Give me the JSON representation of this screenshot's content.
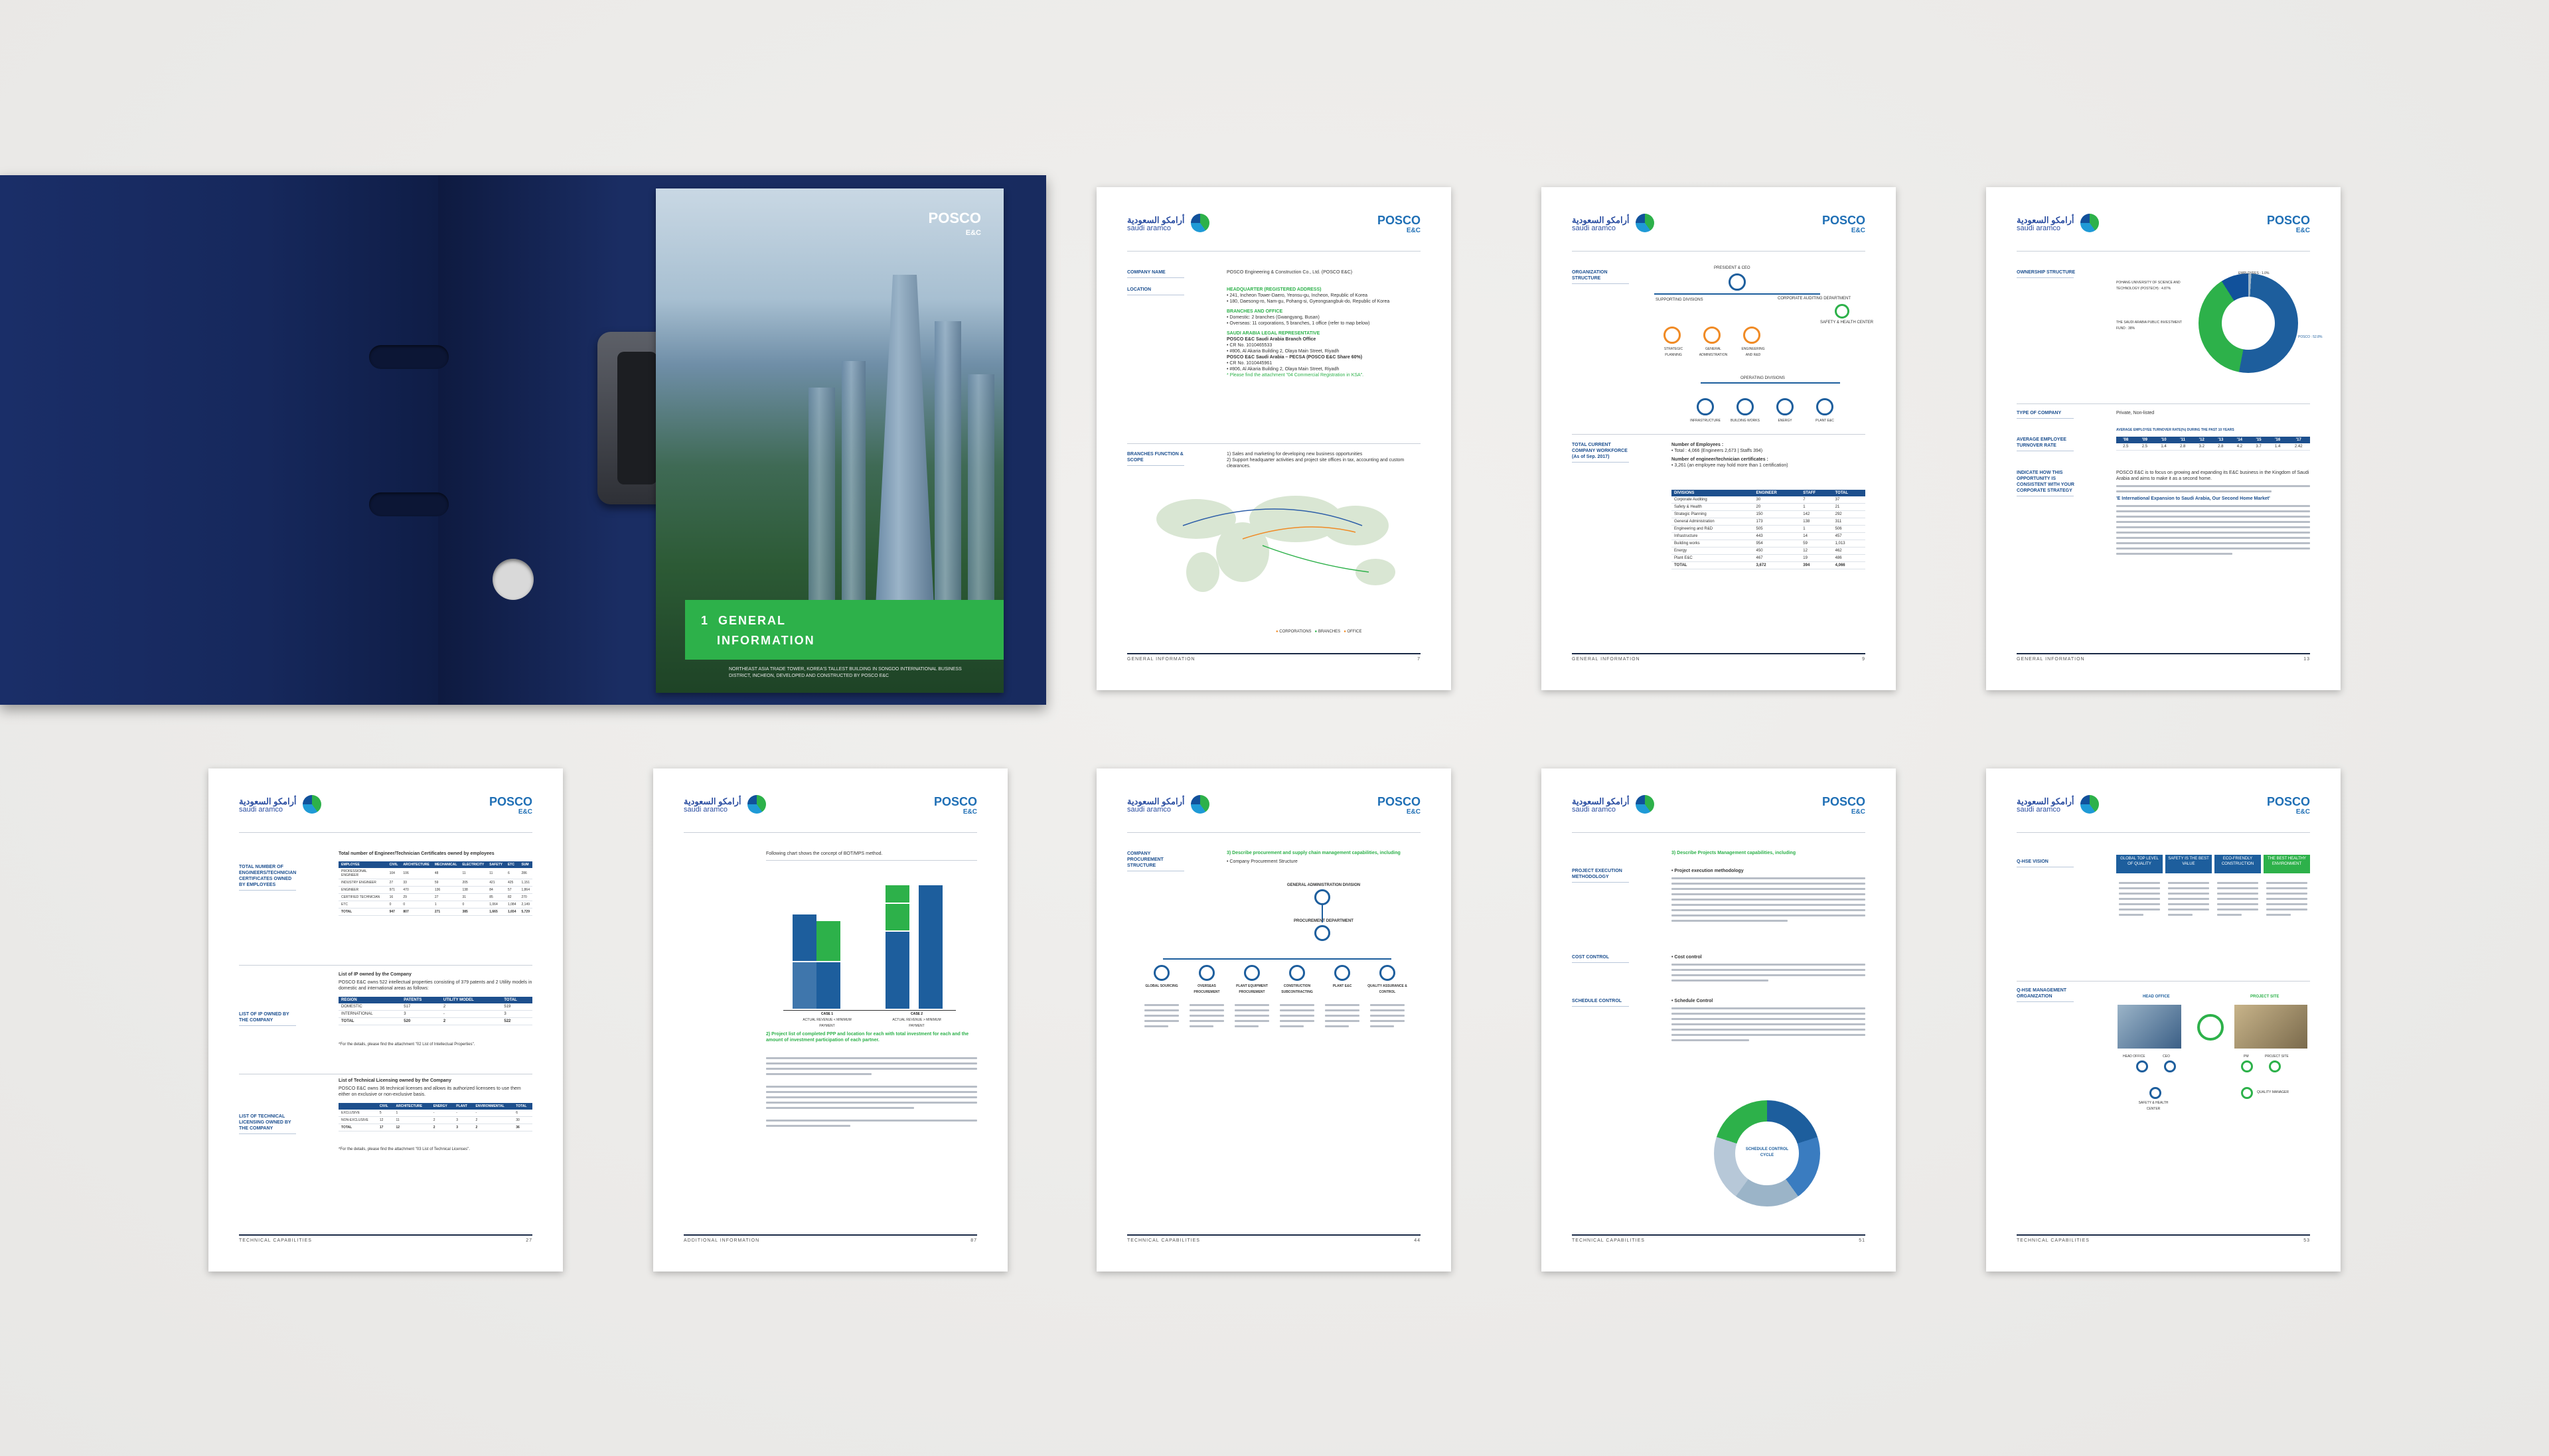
{
  "cover": {
    "section_number": "1",
    "section_title_line1": "GENERAL",
    "section_title_line2": "INFORMATION",
    "logo": "POSCO",
    "logo_sub": "E&C",
    "caption": "NORTHEAST ASIA TRADE TOWER, KOREA'S TALLEST BUILDING IN SONGDO INTERNATIONAL BUSINESS DISTRICT, INCHEON, DEVELOPED AND CONSTRUCTED BY POSCO E&C"
  },
  "brand": {
    "aramco_ar": "أرامكو السعودية",
    "aramco_en": "saudi aramco",
    "posco": "POSCO",
    "posco_sub": "E&C"
  },
  "page1": {
    "label_company": "COMPANY NAME",
    "company": "POSCO Engineering & Construction Co., Ltd. (POSCO E&C)",
    "label_location": "LOCATION",
    "hq_title": "HEADQUARTER (REGISTERED ADDRESS)",
    "hq_line1": "• 241, Incheon Tower-Daero, Yeonsu-gu, Incheon, Republic of Korea",
    "hq_line2": "• 180, Daesong-ro, Nam-gu, Pohang-si, Gyeongsangbuk-do, Republic of Korea",
    "branches_title": "BRANCHES AND OFFICE",
    "branches_line1": "• Domestic: 2 branches (Gwangyang, Busan)",
    "branches_line2": "• Overseas: 11 corporations, 5 branches, 1 office (refer to map below)",
    "saudi_title": "SAUDI ARABIA LEGAL REPRESENTATIVE",
    "saudi_line1": "POSCO E&C Saudi Arabia Branch Office",
    "saudi_line2": "• CR No. 1010465533",
    "saudi_line3": "• #806, Al Akaria Building 2, Olaya Main Street, Riyadh",
    "saudi_line4": "POSCO E&C Saudi Arabia – PECSA (POSCO E&C Share 60%)",
    "saudi_line5": "• CR No. 1010445961",
    "saudi_line6": "• #806, Al Akaria Building 2, Olaya Main Street, Riyadh",
    "saudi_note": "* Please find the attachment \"04 Commercial Registration in KSA\".",
    "label_branches": "BRANCHES FUNCTION & SCOPE",
    "branch_fn1": "1) Sales and marketing for developing new business opportunities",
    "branch_fn2": "2) Support headquarter activities and project site offices in tax, accounting and custom clearances.",
    "legend": [
      "CORPORATIONS",
      "BRANCHES",
      "OFFICE"
    ],
    "footer": "GENERAL INFORMATION",
    "page_no": "7"
  },
  "page2": {
    "label_org": "ORGANIZATION STRUCTURE",
    "top_node": "PRESIDENT & CEO",
    "support": "SUPPORTING DIVISIONS",
    "compliance": "CORPORATE AUDITING DEPARTMENT",
    "safety": "SAFETY & HEALTH CENTER",
    "left_nodes": [
      "STRATEGIC PLANNING",
      "GENERAL ADMINISTRATION",
      "ENGINEERING AND R&D"
    ],
    "operating": "OPERATING DIVISIONS",
    "bottom_nodes": [
      "INFRASTRUCTURE",
      "BUILDING WORKS",
      "ENERGY",
      "PLANT E&C"
    ],
    "label_workforce": "TOTAL CURRENT COMPANY WORKFORCE (As of Sep. 2017)",
    "employees_title": "Number of Employees :",
    "employees_line": "• Total : 4,066 (Engineers 2,673 | Staffs 394)",
    "certs_title": "Number of engineer/technician certificates :",
    "certs_line": "• 3,261 (an employee may hold more than 1 certification)",
    "table_headers": [
      "DIVISIONS",
      "ENGINEER",
      "STAFF",
      "TOTAL"
    ],
    "table_rows": [
      [
        "Corporate Auditing",
        "30",
        "7",
        "37"
      ],
      [
        "Safety & Health",
        "20",
        "1",
        "21"
      ],
      [
        "Strategic Planning",
        "150",
        "142",
        "292"
      ],
      [
        "General Administration",
        "173",
        "138",
        "311"
      ],
      [
        "Engineering and R&D",
        "505",
        "1",
        "506"
      ],
      [
        "Infrastructure",
        "443",
        "14",
        "457"
      ],
      [
        "Building works",
        "954",
        "59",
        "1,013"
      ],
      [
        "Energy",
        "450",
        "12",
        "462"
      ],
      [
        "Plant E&C",
        "467",
        "19",
        "486"
      ]
    ],
    "table_total": [
      "TOTAL",
      "3,672",
      "394",
      "4,066"
    ],
    "footer": "GENERAL INFORMATION",
    "page_no": "9"
  },
  "page3": {
    "label_ownership": "OWNERSHIP STRUCTURE",
    "slice1": "POHANG UNIVERSITY OF SCIENCE AND TECHNOLOGY (POSTECH) : 4.87%",
    "slice2": "THE SAUDI ARABIA PUBLIC INVESTMENT FUND : 38%",
    "slice3": "EMPLOYEES : 1.0%",
    "slice4": "POSCO : 52.8%",
    "label_type": "TYPE OF COMPANY",
    "type": "Private, Non-listed",
    "label_turnover": "AVERAGE EMPLOYEE TURNOVER RATE",
    "turnover_title": "AVERAGE EMPLOYEE TURNOVER RATE(%) DURING THE PAST 10 YEARS",
    "turnover_years": [
      "'08",
      "'09",
      "'10",
      "'11",
      "'12",
      "'13",
      "'14",
      "'15",
      "'16",
      "'17"
    ],
    "turnover_values": [
      "2.5",
      "2.5",
      "1.4",
      "2.8",
      "3.2",
      "2.8",
      "4.2",
      "3.7",
      "1.4",
      "2.42"
    ],
    "label_indicate": "INDICATE HOW THIS OPPORTUNITY IS CONSISTENT WITH YOUR CORPORATE STRATEGY",
    "para1": "POSCO E&C is to focus on growing and expanding its E&C business in the Kingdom of Saudi Arabia and aims to make it as a second home.",
    "subhead": "'E International Expansion to Saudi Arabia, Our Second Home Market'",
    "footer": "GENERAL INFORMATION",
    "page_no": "13"
  },
  "page4": {
    "label1": "TOTAL NUMBER OF ENGINEERS/TECHNICIAN CERTIFICATES OWNED BY EMPLOYEES",
    "title1": "Total number of Engineer/Technician Certificates owned by employees",
    "t1_headers": [
      "EMPLOYEE",
      "CIVIL",
      "ARCHITECTURE",
      "MECHANICAL",
      "ELECTRICITY",
      "SAFETY",
      "ETC",
      "SUM"
    ],
    "t1_rows": [
      [
        "PROFESSIONAL ENGINEER",
        "104",
        "106",
        "48",
        "11",
        "11",
        "6",
        "286"
      ],
      [
        "INDUSTRY ENGINEER",
        "27",
        "33",
        "59",
        "205",
        "421",
        "425",
        "1,151"
      ],
      [
        "ENGINEER",
        "971",
        "470",
        "136",
        "138",
        "84",
        "57",
        "1,864"
      ],
      [
        "CERTIFIED TECHNICIAN",
        "16",
        "29",
        "27",
        "31",
        "85",
        "82",
        "270"
      ],
      [
        "ETC",
        "0",
        "0",
        "1",
        "0",
        "1,064",
        "1,084",
        "2,149"
      ]
    ],
    "t1_total": [
      "TOTAL",
      "947",
      "807",
      "271",
      "385",
      "1,665",
      "1,654",
      "5,729"
    ],
    "label2": "LIST OF IP OWNED BY THE COMPANY",
    "title2": "List of IP owned by the Company",
    "text2": "POSCO E&C owns 522 intellectual properties consisting of 379 patents and 2 Utility models in domestic and international areas as follows:",
    "t2_headers": [
      "REGION",
      "PATENTS",
      "UTILITY MODEL",
      "TOTAL"
    ],
    "t2_rows": [
      [
        "DOMESTIC",
        "517",
        "2",
        "519"
      ],
      [
        "INTERNATIONAL",
        "3",
        "-",
        "3"
      ]
    ],
    "t2_total": [
      "TOTAL",
      "520",
      "2",
      "522"
    ],
    "note2": "*For the details, please find the attachment \"02 List of Intellectual Properties\".",
    "label3": "LIST OF TECHNICAL LICENSING OWNED BY THE COMPANY",
    "title3": "List of Technical Licensing owned by the Company",
    "text3": "POSCO E&C owns 36 technical licenses and allows its authorized licensees to use them either on exclusive or non-exclusive basis.",
    "t3_headers": [
      "",
      "CIVIL",
      "ARCHITECTURE",
      "ENERGY",
      "PLANT",
      "ENVIRONMENTAL",
      "TOTAL"
    ],
    "t3_rows": [
      [
        "EXCLUSIVE",
        "5",
        "1",
        "-",
        "-",
        "-",
        "6"
      ],
      [
        "NON-EXCLUSIVE",
        "12",
        "11",
        "2",
        "3",
        "2",
        "30"
      ]
    ],
    "t3_total": [
      "TOTAL",
      "17",
      "12",
      "2",
      "3",
      "2",
      "36"
    ],
    "note3": "*For the details, please find the attachment \"03 List of Technical Licenses\".",
    "footer": "TECHNICAL CAPABILITIES",
    "page_no": "27"
  },
  "page5": {
    "intro": "Following chart shows the concept of BOT/MPS method.",
    "case1": "CASE 1",
    "case1_sub": "ACTUAL REVENUE < MINIMUM PAYMENT",
    "case2": "CASE 2",
    "case2_sub": "ACTUAL REVENUE > MINIMUM PAYMENT",
    "heading": "2) Project list of completed PPP and location for each with total investment for each and the amount of investment participation of each partner.",
    "footer": "ADDITIONAL INFORMATION",
    "page_no": "87"
  },
  "page6": {
    "label": "COMPANY PROCUREMENT STRUCTURE",
    "heading": "3) Describe procurement and supply chain management capabilities, including",
    "bullet": "• Company Procurement Structure",
    "top": "GENERAL ADMINISTRATION DIVISION",
    "mid": "PROCUREMENT DEPARTMENT",
    "teams": [
      "GLOBAL SOURCING",
      "OVERSEAS PROCUREMENT",
      "PLANT EQUIPMENT PROCUREMENT",
      "CONSTRUCTION SUBCONTRACTING",
      "PLANT E&C",
      "QUALITY ASSURANCE & CONTROL"
    ],
    "footer": "TECHNICAL CAPABILITIES",
    "page_no": "44"
  },
  "page7": {
    "heading": "3) Describe Projects Management capabilities, including",
    "label1": "PROJECT EXECUTION METHODOLOGY",
    "bullet1": "• Project execution methodology",
    "label2": "COST CONTROL",
    "bullet2": "• Cost control",
    "label3": "SCHEDULE CONTROL",
    "bullet3": "• Schedule Control",
    "cycle_center": "SCHEDULE CONTROL CYCLE",
    "footer": "TECHNICAL CAPABILITIES",
    "page_no": "51"
  },
  "page8": {
    "label1": "Q-HSE VISION",
    "vision_heads": [
      "GLOBAL TOP LEVEL OF QUALITY",
      "SAFETY IS THE BEST VALUE",
      "ECO-FRIENDLY CONSTRUCTION",
      "THE BEST HEALTHY ENVIRONMENT"
    ],
    "label2": "Q-HSE MANAGEMENT ORGANIZATION",
    "head_office": "HEAD OFFICE",
    "project_site": "PROJECT SITE",
    "nodes_left": [
      "HEAD OFFICE",
      "CEO",
      "SAFETY & HEALTH CENTER"
    ],
    "nodes_right": [
      "PM",
      "PROJECT SITE",
      "QUALITY MANAGER"
    ],
    "footer": "TECHNICAL CAPABILITIES",
    "page_no": "53"
  },
  "colors": {
    "navy": "#14275a",
    "posco_blue": "#1f6fb5",
    "green": "#2db14a",
    "orange": "#f08a24"
  }
}
